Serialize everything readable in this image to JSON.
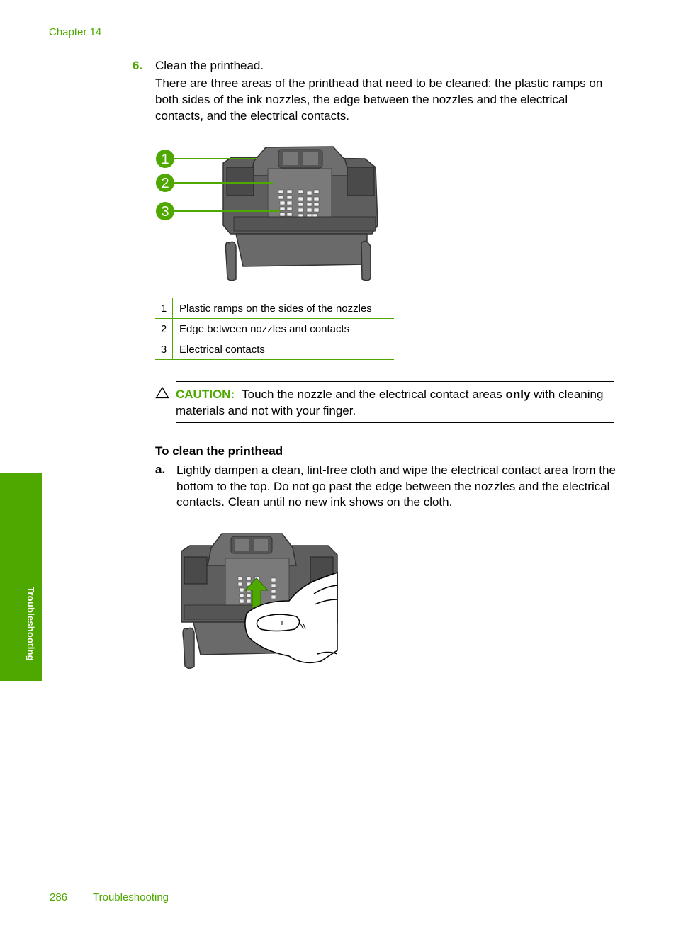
{
  "header": {
    "chapter": "Chapter 14"
  },
  "step": {
    "number": "6.",
    "title": "Clean the printhead.",
    "body": "There are three areas of the printhead that need to be cleaned: the plastic ramps on both sides of the ink nozzles, the edge between the nozzles and the electrical contacts, and the electrical contacts."
  },
  "figure1": {
    "callouts": [
      "1",
      "2",
      "3"
    ],
    "description": "Printhead with callouts"
  },
  "legend": [
    {
      "num": "1",
      "text": "Plastic ramps on the sides of the nozzles"
    },
    {
      "num": "2",
      "text": "Edge between nozzles and contacts"
    },
    {
      "num": "3",
      "text": "Electrical contacts"
    }
  ],
  "caution": {
    "icon": "caution-triangle-icon",
    "label": "CAUTION:",
    "text_before": "Touch the nozzle and the electrical contact areas ",
    "text_bold": "only",
    "text_after": " with cleaning materials and not with your finger."
  },
  "procedure": {
    "title": "To clean the printhead",
    "steps": [
      {
        "label": "a.",
        "text": "Lightly dampen a clean, lint-free cloth and wipe the electrical contact area from the bottom to the top. Do not go past the edge between the nozzles and the electrical contacts. Clean until no new ink shows on the cloth."
      }
    ]
  },
  "side_tab": {
    "label": "Troubleshooting"
  },
  "footer": {
    "page_number": "286",
    "section": "Troubleshooting"
  },
  "colors": {
    "accent": "#4fa800",
    "printhead": "#6b6b6b",
    "text": "#000000"
  }
}
